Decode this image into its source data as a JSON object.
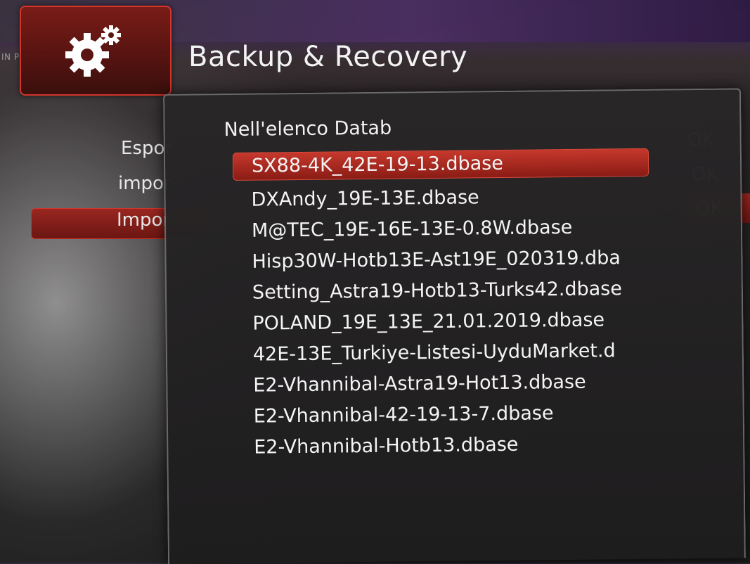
{
  "header": {
    "title": "Backup & Recovery",
    "tile_badge": "IN PRIMA",
    "tile_icon": "gear-icon"
  },
  "background_menu": {
    "items": [
      {
        "label": "Espor"
      },
      {
        "label": "impor"
      },
      {
        "label": "Impor"
      }
    ],
    "ok_labels": [
      "OK",
      "OK",
      "OK"
    ]
  },
  "dialog": {
    "title": "Nell'elenco Datab",
    "files": [
      "SX88-4K_42E-19-13.dbase",
      "DXAndy_19E-13E.dbase",
      "M@TEC_19E-16E-13E-0.8W.dbase",
      "Hisp30W-Hotb13E-Ast19E_020319.dba",
      "Setting_Astra19-Hotb13-Turks42.dbase",
      "POLAND_19E_13E_21.01.2019.dbase",
      "42E-13E_Turkiye-Listesi-UyduMarket.d",
      "E2-Vhannibal-Astra19-Hot13.dbase",
      "E2-Vhannibal-42-19-13-7.dbase",
      "E2-Vhannibal-Hotb13.dbase"
    ],
    "selected_index": 0
  },
  "colors": {
    "accent_red": "#c6382c",
    "panel_bg": "#282627",
    "purple_band": "#4b2f63"
  }
}
